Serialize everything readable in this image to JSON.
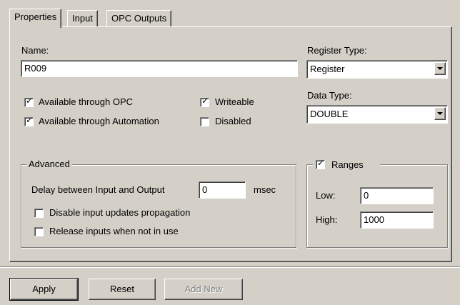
{
  "tabs": [
    {
      "label": "Properties",
      "active": true
    },
    {
      "label": "Input",
      "active": false
    },
    {
      "label": "OPC Outputs",
      "active": false
    }
  ],
  "name": {
    "label": "Name:",
    "value": "R009"
  },
  "register_type": {
    "label": "Register Type:",
    "value": "Register"
  },
  "data_type": {
    "label": "Data Type:",
    "value": "DOUBLE"
  },
  "checkboxes": {
    "opc": {
      "label": "Available through OPC",
      "checked": true
    },
    "automation": {
      "label": "Available through Automation",
      "checked": true
    },
    "writeable": {
      "label": "Writeable",
      "checked": true
    },
    "disabled": {
      "label": "Disabled",
      "checked": false
    }
  },
  "advanced": {
    "legend": "Advanced",
    "delay_label": "Delay between Input and Output",
    "delay_value": "0",
    "delay_unit": "msec",
    "disable_propagation": {
      "label": "Disable input updates propagation",
      "checked": false
    },
    "release_inputs": {
      "label": "Release inputs when not in use",
      "checked": false
    }
  },
  "ranges": {
    "legend": "Ranges",
    "checked": true,
    "low_label": "Low:",
    "low_value": "0",
    "high_label": "High:",
    "high_value": "1000"
  },
  "buttons": {
    "apply": "Apply",
    "reset": "Reset",
    "add_new": "Add New"
  },
  "check_glyph": "✓",
  "colors": {
    "face": "#d4d0c8",
    "shadow": "#808080",
    "highlight": "#ffffff",
    "disabled_text": "#808080"
  }
}
